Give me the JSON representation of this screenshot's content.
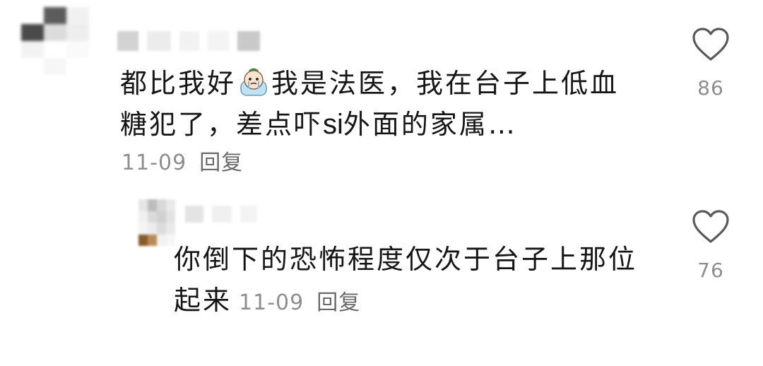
{
  "comments": [
    {
      "text_before_emoji": "都比我好",
      "text_after_emoji": "我是法医，我在台子上低血",
      "text_line2_before": "糖犯了，差点吓",
      "text_line2_latin": "si",
      "text_line2_after": "外面的家属…",
      "date": "11-09",
      "reply_label": "回复",
      "like_count": "86",
      "emoji": "crying-emoji"
    },
    {
      "text_line1": "你倒下的恐怖程度仅次于台子上那位",
      "text_line2": "起来",
      "date": "11-09",
      "reply_label": "回复",
      "like_count": "76"
    }
  ],
  "icons": {
    "like": "heart-outline-icon"
  },
  "colors": {
    "text": "#161616",
    "meta": "#8e8e8e",
    "icon_stroke": "#5a5a5a"
  }
}
